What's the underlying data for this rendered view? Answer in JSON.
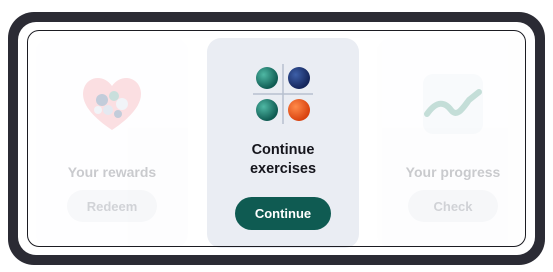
{
  "cards": {
    "rewards": {
      "title": "Your rewards",
      "button_label": "Redeem",
      "icon": "heart-gift-icon"
    },
    "exercises": {
      "title": "Continue exercises",
      "button_label": "Continue",
      "icon": "molecule-grid-icon"
    },
    "progress": {
      "title": "Your progress",
      "button_label": "Check",
      "icon": "trend-line-icon"
    }
  },
  "colors": {
    "frame": "#2b2b34",
    "primary_button": "#0f5b52",
    "center_card_bg": "#eaedf3"
  }
}
